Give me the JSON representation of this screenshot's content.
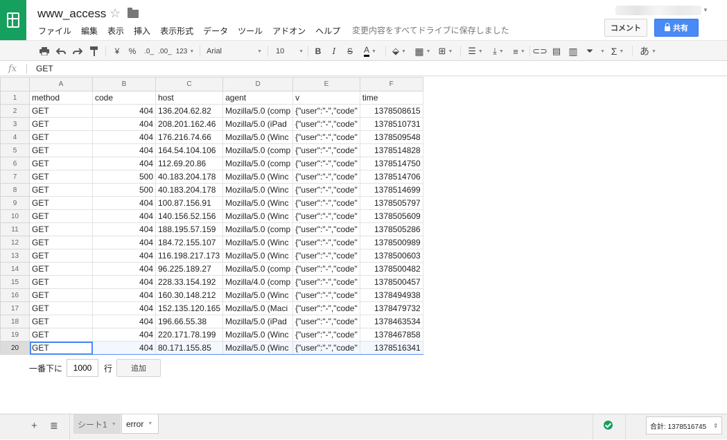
{
  "header": {
    "title": "www_access",
    "save_status": "変更内容をすべてドライブに保存しました",
    "comment_label": "コメント",
    "share_label": "共有"
  },
  "menu": [
    "ファイル",
    "編集",
    "表示",
    "挿入",
    "表示形式",
    "データ",
    "ツール",
    "アドオン",
    "ヘルプ"
  ],
  "toolbar": {
    "currency": "¥",
    "percent": "%",
    "dec_less": ".0_",
    "dec_more": ".00_",
    "format_more": "123",
    "font": "Arial",
    "font_size": "10",
    "bold": "B",
    "italic": "I",
    "strike": "S",
    "text_color": "A",
    "input_tool": "あ"
  },
  "formula": {
    "icon": "fx",
    "value": "GET"
  },
  "grid": {
    "columns": [
      "A",
      "B",
      "C",
      "D",
      "E",
      "F"
    ],
    "rows": [
      {
        "n": "1",
        "cells": [
          "method",
          "code",
          "host",
          "agent",
          "v",
          "time"
        ]
      },
      {
        "n": "2",
        "cells": [
          "GET",
          "404",
          "136.204.62.82",
          "Mozilla/5.0 (comp",
          "{\"user\":\"-\",\"code\"",
          "1378508615"
        ]
      },
      {
        "n": "3",
        "cells": [
          "GET",
          "404",
          "208.201.162.46",
          "Mozilla/5.0 (iPad",
          "{\"user\":\"-\",\"code\"",
          "1378510731"
        ]
      },
      {
        "n": "4",
        "cells": [
          "GET",
          "404",
          "176.216.74.66",
          "Mozilla/5.0 (Winc",
          "{\"user\":\"-\",\"code\"",
          "1378509548"
        ]
      },
      {
        "n": "5",
        "cells": [
          "GET",
          "404",
          "164.54.104.106",
          "Mozilla/5.0 (comp",
          "{\"user\":\"-\",\"code\"",
          "1378514828"
        ]
      },
      {
        "n": "6",
        "cells": [
          "GET",
          "404",
          "112.69.20.86",
          "Mozilla/5.0 (comp",
          "{\"user\":\"-\",\"code\"",
          "1378514750"
        ]
      },
      {
        "n": "7",
        "cells": [
          "GET",
          "500",
          "40.183.204.178",
          "Mozilla/5.0 (Winc",
          "{\"user\":\"-\",\"code\"",
          "1378514706"
        ]
      },
      {
        "n": "8",
        "cells": [
          "GET",
          "500",
          "40.183.204.178",
          "Mozilla/5.0 (Winc",
          "{\"user\":\"-\",\"code\"",
          "1378514699"
        ]
      },
      {
        "n": "9",
        "cells": [
          "GET",
          "404",
          "100.87.156.91",
          "Mozilla/5.0 (Winc",
          "{\"user\":\"-\",\"code\"",
          "1378505797"
        ]
      },
      {
        "n": "10",
        "cells": [
          "GET",
          "404",
          "140.156.52.156",
          "Mozilla/5.0 (Winc",
          "{\"user\":\"-\",\"code\"",
          "1378505609"
        ]
      },
      {
        "n": "11",
        "cells": [
          "GET",
          "404",
          "188.195.57.159",
          "Mozilla/5.0 (comp",
          "{\"user\":\"-\",\"code\"",
          "1378505286"
        ]
      },
      {
        "n": "12",
        "cells": [
          "GET",
          "404",
          "184.72.155.107",
          "Mozilla/5.0 (Winc",
          "{\"user\":\"-\",\"code\"",
          "1378500989"
        ]
      },
      {
        "n": "13",
        "cells": [
          "GET",
          "404",
          "116.198.217.173",
          "Mozilla/5.0 (Winc",
          "{\"user\":\"-\",\"code\"",
          "1378500603"
        ]
      },
      {
        "n": "14",
        "cells": [
          "GET",
          "404",
          "96.225.189.27",
          "Mozilla/5.0 (comp",
          "{\"user\":\"-\",\"code\"",
          "1378500482"
        ]
      },
      {
        "n": "15",
        "cells": [
          "GET",
          "404",
          "228.33.154.192",
          "Mozilla/4.0 (comp",
          "{\"user\":\"-\",\"code\"",
          "1378500457"
        ]
      },
      {
        "n": "16",
        "cells": [
          "GET",
          "404",
          "160.30.148.212",
          "Mozilla/5.0 (Winc",
          "{\"user\":\"-\",\"code\"",
          "1378494938"
        ]
      },
      {
        "n": "17",
        "cells": [
          "GET",
          "404",
          "152.135.120.165",
          "Mozilla/5.0 (Maci",
          "{\"user\":\"-\",\"code\"",
          "1378479732"
        ]
      },
      {
        "n": "18",
        "cells": [
          "GET",
          "404",
          "196.66.55.38",
          "Mozilla/5.0 (iPad",
          "{\"user\":\"-\",\"code\"",
          "1378463534"
        ]
      },
      {
        "n": "19",
        "cells": [
          "GET",
          "404",
          "220.171.78.199",
          "Mozilla/5.0 (Winc",
          "{\"user\":\"-\",\"code\"",
          "1378467858"
        ]
      },
      {
        "n": "20",
        "cells": [
          "GET",
          "404",
          "80.171.155.85",
          "Mozilla/5.0 (Winc",
          "{\"user\":\"-\",\"code\"",
          "1378516341"
        ]
      }
    ],
    "selected_row": "20"
  },
  "add_rows": {
    "prefix": "一番下に",
    "count": "1000",
    "suffix": "行",
    "button": "追加"
  },
  "footer": {
    "tabs": [
      {
        "label": "シート1",
        "active": false
      },
      {
        "label": "error",
        "active": true
      }
    ],
    "sum_label": "合計: 1378516745"
  },
  "colors": {
    "brand": "#16a05e",
    "share": "#4a8af4",
    "selection": "#4a8af4"
  }
}
